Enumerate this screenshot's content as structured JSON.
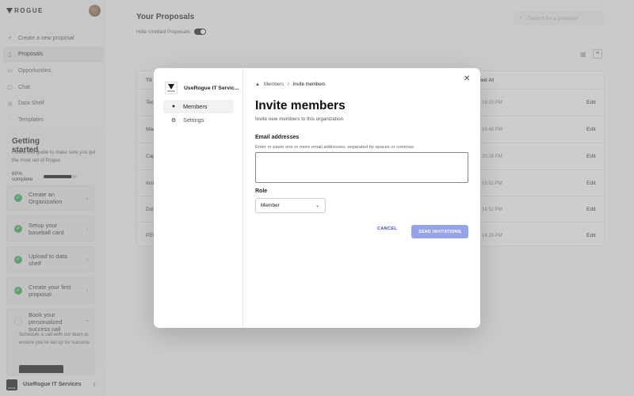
{
  "brand": {
    "name": "ROGUE"
  },
  "sidebar": {
    "items": [
      {
        "label": "Create a new proposal",
        "icon": "plus-icon"
      },
      {
        "label": "Proposals",
        "icon": "document-icon",
        "active": true
      },
      {
        "label": "Opportunities",
        "icon": "clipboard-icon"
      },
      {
        "label": "Chat",
        "icon": "chat-icon"
      },
      {
        "label": "Data Shelf",
        "icon": "database-icon"
      },
      {
        "label": "Templates",
        "icon": "sliders-icon"
      }
    ]
  },
  "getting_started": {
    "title": "Getting started",
    "description": "Follow this guide to make sure you get the most out of Rogue.",
    "progress_text": "80% complete",
    "progress_value": 0.8,
    "steps": [
      {
        "label": "Create an Organization",
        "done": true
      },
      {
        "label": "Setup your baseball card",
        "done": true
      },
      {
        "label": "Upload to data shelf",
        "done": true
      },
      {
        "label": "Create your first proposal",
        "done": true
      },
      {
        "label": "Book your personalized success call",
        "done": false
      }
    ],
    "step_detail": "Schedule a call with our team to ensure you're set up for success."
  },
  "org_footer": {
    "name": "UseRogue IT Services"
  },
  "main": {
    "title": "Your Proposals",
    "hide_untitled_label": "Hide Untitled Proposals",
    "search_placeholder": "Search for a proposal",
    "table": {
      "col_title": "Tit",
      "col_updated": "ted At",
      "rows": [
        {
          "title": "Tec",
          "date": "3 19:10 PM",
          "action": "Edit"
        },
        {
          "title": "Mar",
          "date": "3 16:48 PM",
          "action": "Edit"
        },
        {
          "title": "Cap",
          "date": "3 20:28 PM",
          "action": "Edit"
        },
        {
          "title": "Inst",
          "date": "3 15:52 PM",
          "action": "Edit"
        },
        {
          "title": "Dol",
          "date": "3 14:52 PM",
          "action": "Edit"
        },
        {
          "title": "PEI",
          "date": "3 14:19 PM",
          "action": "Edit"
        }
      ]
    }
  },
  "modal": {
    "org_name": "UseRogue IT Servic...",
    "org_logo_text": "ROGUE",
    "nav": [
      {
        "label": "Members",
        "active": true
      },
      {
        "label": "Settings",
        "active": false
      }
    ],
    "breadcrumb": {
      "parent": "Members",
      "separator": "/",
      "current": "Invite members"
    },
    "title": "Invite members",
    "subtitle": "Invite new members to this organization",
    "email_label": "Email addresses",
    "email_hint": "Enter or paste one or more email addresses, separated by spaces or commas",
    "email_value": "",
    "role_label": "Role",
    "role_value": "Member",
    "cancel_label": "CANCEL",
    "send_label": "SEND INVITATIONS",
    "colors": {
      "accent": "#3a4fb3",
      "send_disabled": "#95a4e8",
      "success": "#3aa65a"
    }
  }
}
